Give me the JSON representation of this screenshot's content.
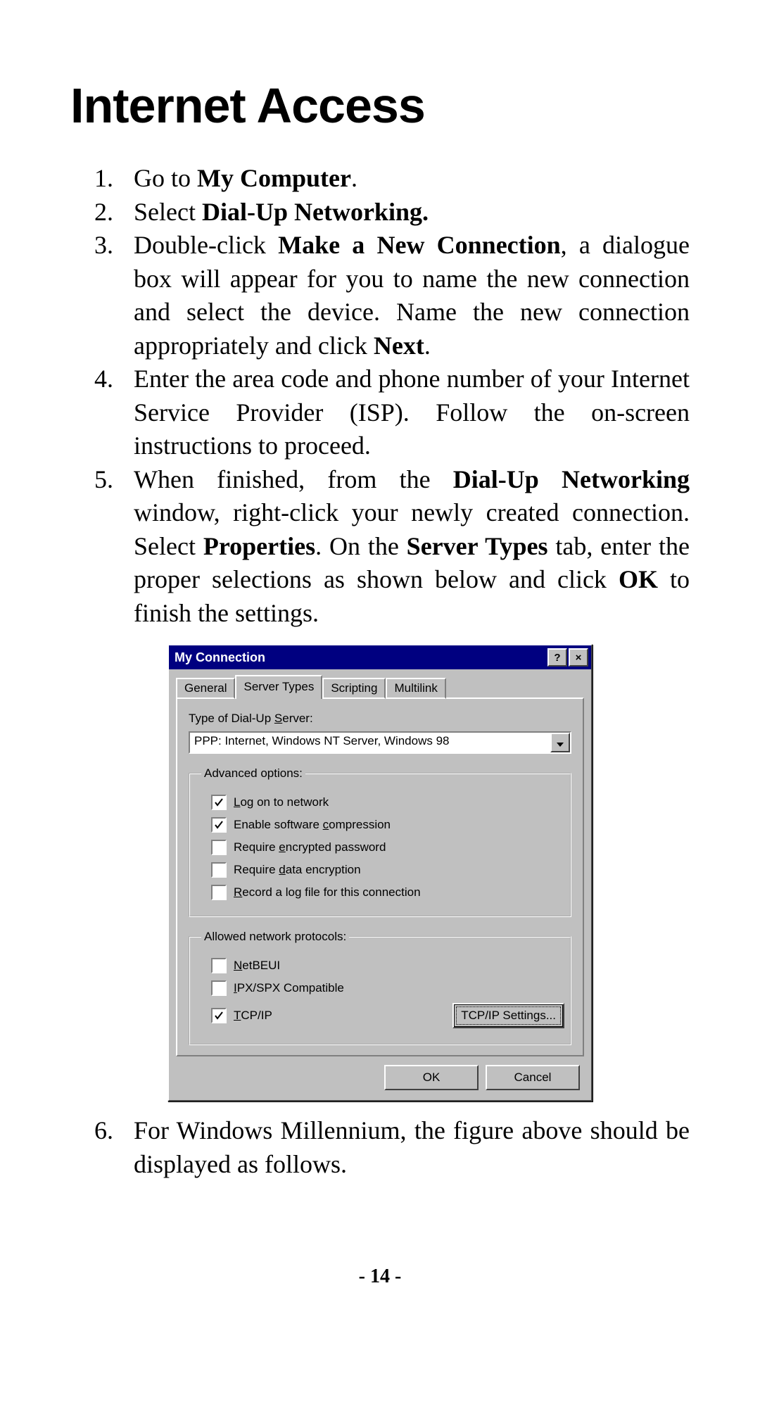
{
  "page": {
    "title": "Internet Access",
    "number": "- 14 -"
  },
  "steps": {
    "s1_pre": "Go to ",
    "s1_b": "My Computer",
    "s1_post": ".",
    "s2_pre": "Select ",
    "s2_b": "Dial-Up Networking.",
    "s3_pre": "Double-click ",
    "s3_b": "Make a New Connection",
    "s3_post1": ", a dialogue box will appear for you to name the new connection and select the device. Name the new connection appropriately and click ",
    "s3_b2": "Next",
    "s3_post2": ".",
    "s4": "Enter the area code and phone number of your Internet Service Provider (ISP). Follow the on-screen instructions to proceed.",
    "s5_pre": "When finished, from the ",
    "s5_b1": "Dial-Up Networking",
    "s5_mid1": " window, right-click your newly created connection.  Select ",
    "s5_b2": "Properties",
    "s5_mid2": ". On the ",
    "s5_b3": "Server Types",
    "s5_mid3": " tab, enter the proper selections as shown below and click ",
    "s5_b4": "OK",
    "s5_post": " to finish the settings.",
    "s6": "For Windows Millennium, the figure above should be displayed as follows."
  },
  "dialog": {
    "title": "My Connection",
    "help_glyph": "?",
    "close_glyph": "×",
    "tabs": {
      "general": "General",
      "server_types": "Server Types",
      "scripting": "Scripting",
      "multilink": "Multilink"
    },
    "server_label_pre": "Type of Dial-Up ",
    "server_label_u": "S",
    "server_label_post": "erver:",
    "server_value": "PPP: Internet, Windows NT Server, Windows 98",
    "adv_legend": "Advanced options:",
    "adv": {
      "log_on": {
        "checked": true,
        "u": "L",
        "rest": "og on to network"
      },
      "compress": {
        "checked": true,
        "pre": "Enable software ",
        "u": "c",
        "rest": "ompression"
      },
      "enc_pw": {
        "checked": false,
        "pre": "Require ",
        "u": "e",
        "rest": "ncrypted password"
      },
      "data_enc": {
        "checked": false,
        "pre": "Require ",
        "u": "d",
        "rest": "ata encryption"
      },
      "log_file": {
        "checked": false,
        "u": "R",
        "rest": "ecord a log file for this connection"
      }
    },
    "proto_legend": "Allowed network protocols:",
    "proto": {
      "netbeui": {
        "checked": false,
        "u": "N",
        "rest": "etBEUI"
      },
      "ipx": {
        "checked": false,
        "u": "I",
        "rest": "PX/SPX Compatible"
      },
      "tcpip": {
        "checked": true,
        "u": "T",
        "rest": "CP/IP"
      }
    },
    "tcpip_settings_btn": "TCP/IP Settings...",
    "ok": "OK",
    "cancel": "Cancel"
  }
}
